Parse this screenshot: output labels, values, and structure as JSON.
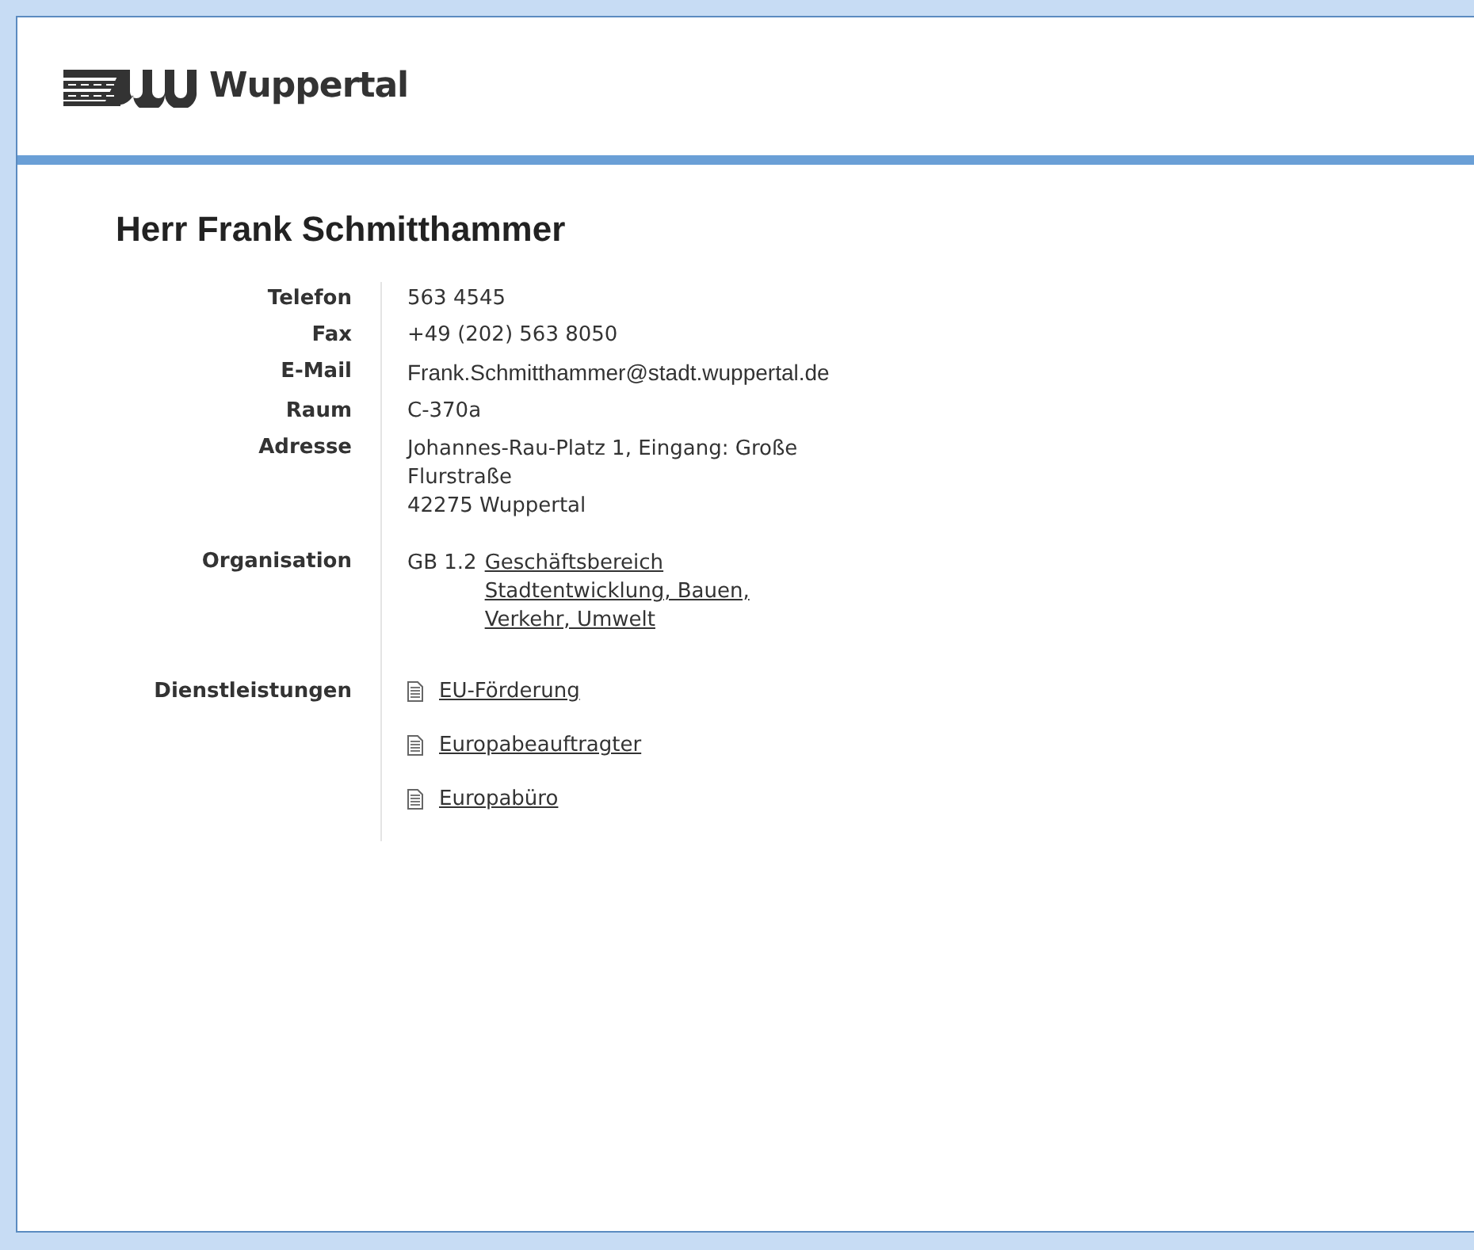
{
  "logo": {
    "text": "Wuppertal"
  },
  "title": "Herr Frank Schmitthammer",
  "fields": [
    {
      "kind": "text",
      "label": "Telefon",
      "value": "563 4545"
    },
    {
      "kind": "text",
      "label": "Fax",
      "value": "+49 (202) 563 8050"
    },
    {
      "kind": "email",
      "label": "E-Mail",
      "value": "Frank.Schmitthammer@stadt.wuppertal.de"
    },
    {
      "kind": "text",
      "label": "Raum",
      "value": "C-370a"
    },
    {
      "kind": "lines",
      "label": "Adresse",
      "lines": [
        "Johannes-Rau-Platz 1, Eingang: Große",
        "Flurstraße",
        "42275 Wuppertal"
      ]
    },
    {
      "kind": "org",
      "label": "Organisation",
      "code": "GB 1.2",
      "link_lines": [
        "Geschäftsbereich",
        "Stadtentwicklung, Bauen,",
        "Verkehr, Umwelt"
      ]
    },
    {
      "kind": "links",
      "label": "Dienstleistungen",
      "items": [
        "EU-Förderung",
        "Europabeauftragter",
        "Europabüro"
      ]
    }
  ]
}
